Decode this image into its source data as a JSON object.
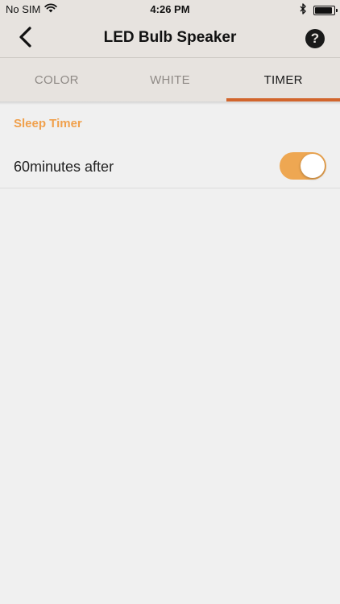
{
  "status_bar": {
    "carrier": "No SIM",
    "time": "4:26 PM",
    "battery_level": 0.9
  },
  "nav": {
    "title": "LED Bulb Speaker",
    "help_symbol": "?",
    "back_icon": "chevron-left-icon",
    "help_icon": "question-circle-icon"
  },
  "tabs": [
    {
      "label": "COLOR",
      "active": false
    },
    {
      "label": "WHITE",
      "active": false
    },
    {
      "label": "TIMER",
      "active": true
    }
  ],
  "timer": {
    "section_title": "Sleep Timer",
    "row_label": "60minutes after",
    "enabled": true
  },
  "colors": {
    "accent": "#d2652c",
    "section_header": "#f0a04c",
    "toggle_on": "#eea752",
    "chrome_bg": "#e7e3df"
  }
}
